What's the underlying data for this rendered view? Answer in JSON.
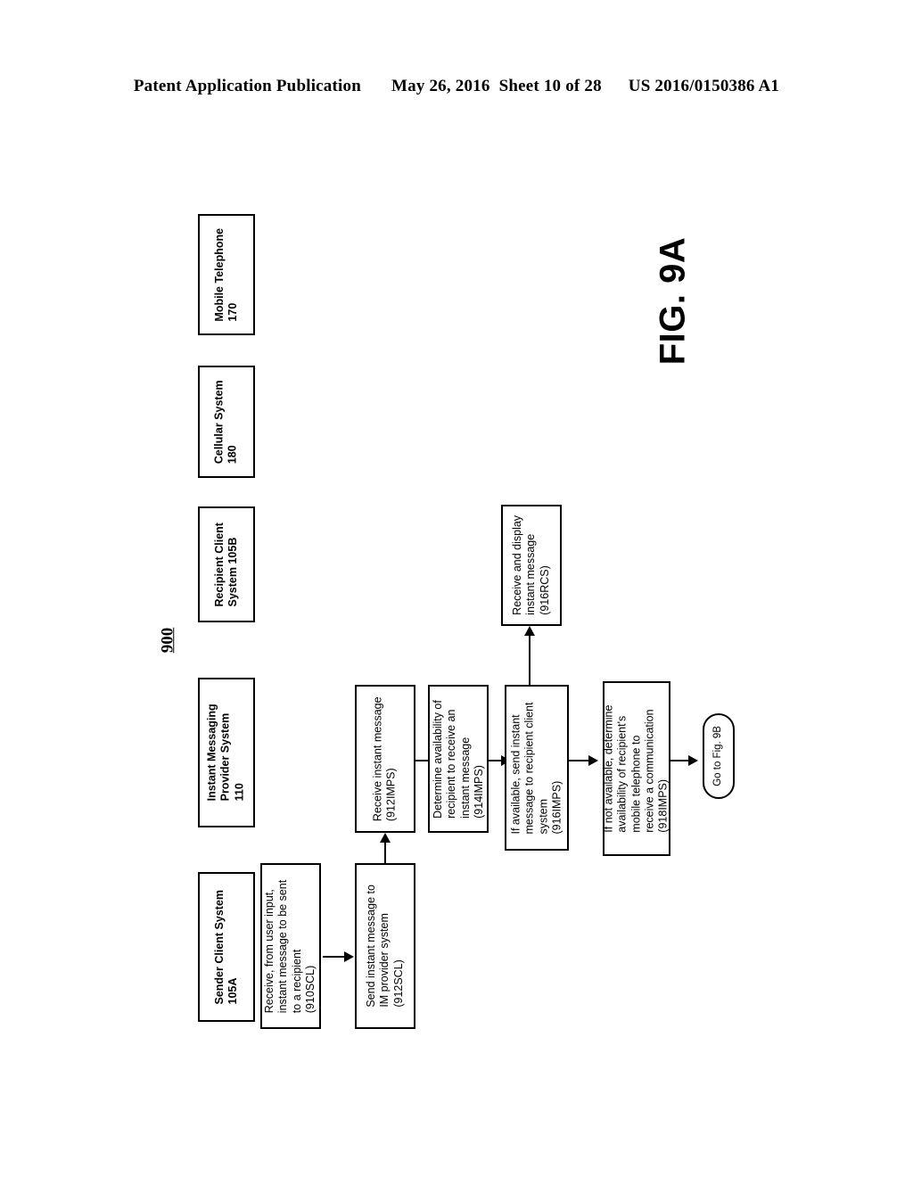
{
  "header": {
    "publication": "Patent Application Publication",
    "date": "May 26, 2016",
    "sheet": "Sheet 10 of 28",
    "patent_number": "US 2016/0150386 A1"
  },
  "figure": {
    "label": "FIG. 9A",
    "reference_numeral": "900"
  },
  "lane_headers": [
    {
      "id": "mobile-telephone",
      "lines": [
        "Mobile Telephone",
        "170"
      ]
    },
    {
      "id": "cellular-system",
      "lines": [
        "Cellular System",
        "180"
      ]
    },
    {
      "id": "recipient-client-system",
      "lines": [
        "Recipient Client",
        "System 105B"
      ]
    },
    {
      "id": "instant-messaging-provider-system",
      "lines": [
        "Instant Messaging",
        "Provider System",
        "110"
      ]
    },
    {
      "id": "sender-client-system",
      "lines": [
        "Sender Client System",
        "105A"
      ]
    }
  ],
  "process_boxes": [
    {
      "id": "910scl",
      "lines": [
        "Receive, from user input,",
        "instant message to be sent",
        "to a recipient",
        "(910SCL)"
      ]
    },
    {
      "id": "912scl",
      "lines": [
        "Send instant message to",
        "IM provider system",
        "(912SCL)"
      ]
    },
    {
      "id": "912imps",
      "lines": [
        "Receive instant message",
        "(912IMPS)"
      ]
    },
    {
      "id": "914imps",
      "lines": [
        "Determine availability of",
        "recipient to receive an",
        "instant message",
        "(914IMPS)"
      ]
    },
    {
      "id": "916imps",
      "lines": [
        "If available, send instant",
        "message to recipient client",
        "system",
        "(916IMPS)"
      ]
    },
    {
      "id": "918imps",
      "lines": [
        "If not available, determine",
        "availability of recipient's",
        "mobile telephone to",
        "receive a communication",
        "(918IMPS)"
      ]
    },
    {
      "id": "916rcs",
      "lines": [
        "Receive and display",
        "instant message",
        "(916RCS)"
      ]
    }
  ],
  "connector": {
    "id": "go-to-fig-9b",
    "label": "Go to Fig. 9B"
  },
  "colors": {
    "ink": "#000000",
    "paper": "#ffffff"
  }
}
